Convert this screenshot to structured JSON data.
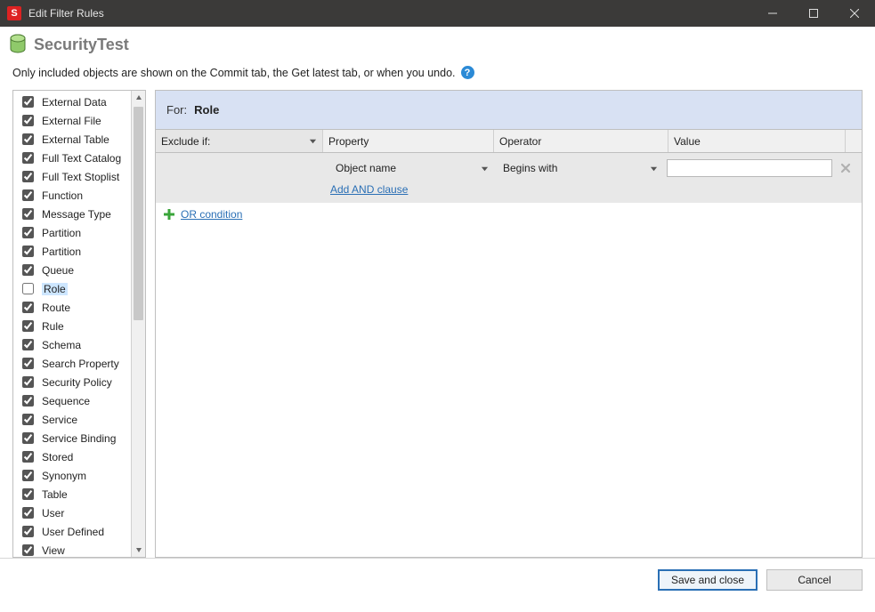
{
  "window": {
    "title": "Edit Filter Rules"
  },
  "header": {
    "title": "SecurityTest"
  },
  "info": {
    "text": "Only included objects are shown on the Commit tab, the Get latest tab, or when you undo."
  },
  "sidebar": {
    "items": [
      {
        "label": "External Data",
        "checked": true
      },
      {
        "label": "External File",
        "checked": true
      },
      {
        "label": "External Table",
        "checked": true
      },
      {
        "label": "Full Text Catalog",
        "checked": true
      },
      {
        "label": "Full Text Stoplist",
        "checked": true
      },
      {
        "label": "Function",
        "checked": true
      },
      {
        "label": "Message Type",
        "checked": true
      },
      {
        "label": "Partition",
        "checked": true
      },
      {
        "label": "Partition",
        "checked": true
      },
      {
        "label": "Queue",
        "checked": true
      },
      {
        "label": "Role",
        "checked": false,
        "selected": true
      },
      {
        "label": "Route",
        "checked": true
      },
      {
        "label": "Rule",
        "checked": true
      },
      {
        "label": "Schema",
        "checked": true
      },
      {
        "label": "Search Property",
        "checked": true
      },
      {
        "label": "Security Policy",
        "checked": true
      },
      {
        "label": "Sequence",
        "checked": true
      },
      {
        "label": "Service",
        "checked": true
      },
      {
        "label": "Service Binding",
        "checked": true
      },
      {
        "label": "Stored",
        "checked": true
      },
      {
        "label": "Synonym",
        "checked": true
      },
      {
        "label": "Table",
        "checked": true
      },
      {
        "label": "User",
        "checked": true
      },
      {
        "label": "User Defined",
        "checked": true
      },
      {
        "label": "View",
        "checked": true
      }
    ]
  },
  "panel": {
    "for_label": "For:",
    "for_value": "Role",
    "columns": {
      "exclude": "Exclude if:",
      "property": "Property",
      "operator": "Operator",
      "value": "Value"
    },
    "rule": {
      "property": "Object name",
      "operator": "Begins with",
      "value": ""
    },
    "add_and": "Add AND clause",
    "or_condition": "OR condition"
  },
  "footer": {
    "save": "Save and close",
    "cancel": "Cancel"
  }
}
